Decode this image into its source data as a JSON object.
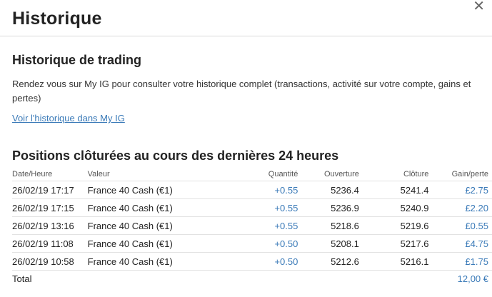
{
  "header": {
    "title": "Historique",
    "close_symbol": "✕"
  },
  "trading": {
    "title": "Historique de trading",
    "description": "Rendez vous sur My IG pour consulter votre historique complet (transactions, activité sur votre compte, gains et pertes)",
    "link": "Voir l'historique dans My IG"
  },
  "positions": {
    "title": "Positions clôturées au cours des dernières 24 heures",
    "columns": [
      "Date/Heure",
      "Valeur",
      "Quantité",
      "Ouverture",
      "Clôture",
      "Gain/perte"
    ],
    "rows": [
      {
        "date": "26/02/19 17:17",
        "valeur": "France 40 Cash (€1)",
        "quantite": "+0.55",
        "ouverture": "5236.4",
        "cloture": "5241.4",
        "gain": "£2.75"
      },
      {
        "date": "26/02/19 17:15",
        "valeur": "France 40 Cash (€1)",
        "quantite": "+0.55",
        "ouverture": "5236.9",
        "cloture": "5240.9",
        "gain": "£2.20"
      },
      {
        "date": "26/02/19 13:16",
        "valeur": "France 40 Cash (€1)",
        "quantite": "+0.55",
        "ouverture": "5218.6",
        "cloture": "5219.6",
        "gain": "£0.55"
      },
      {
        "date": "26/02/19 11:08",
        "valeur": "France 40 Cash (€1)",
        "quantite": "+0.50",
        "ouverture": "5208.1",
        "cloture": "5217.6",
        "gain": "£4.75"
      },
      {
        "date": "26/02/19 10:58",
        "valeur": "France 40 Cash (€1)",
        "quantite": "+0.50",
        "ouverture": "5212.6",
        "cloture": "5216.1",
        "gain": "£1.75"
      }
    ],
    "total_label": "Total",
    "total_value": "12,00 €"
  }
}
